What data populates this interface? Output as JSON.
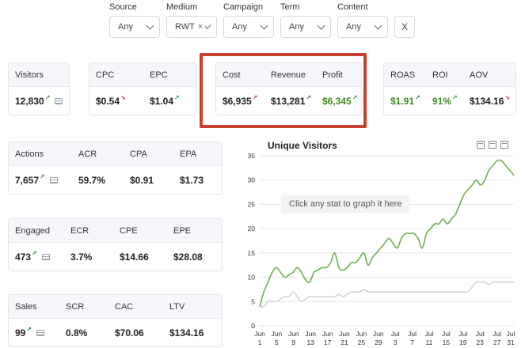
{
  "filters": {
    "source": {
      "label": "Source",
      "value": "Any"
    },
    "medium": {
      "label": "Medium",
      "value": "RWT",
      "clear": "×"
    },
    "campaign": {
      "label": "Campaign",
      "value": "Any"
    },
    "term": {
      "label": "Term",
      "value": "Any"
    },
    "content": {
      "label": "Content",
      "value": "Any"
    },
    "clear_all_label": "X"
  },
  "cards": {
    "visitors": {
      "label": "Visitors",
      "value": "12,830",
      "trend": "up"
    },
    "cpc": {
      "label": "CPC",
      "value": "$0.54",
      "trend": "down"
    },
    "epc": {
      "label": "EPC",
      "value": "$1.04",
      "trend": "up"
    },
    "cost": {
      "label": "Cost",
      "value": "$6,935",
      "trend": "up"
    },
    "revenue": {
      "label": "Revenue",
      "value": "$13,281",
      "trend": "up"
    },
    "profit": {
      "label": "Profit",
      "value": "$6,345",
      "trend": "up"
    },
    "roas": {
      "label": "ROAS",
      "value": "$1.91",
      "trend": "up"
    },
    "roi": {
      "label": "ROI",
      "value": "91%",
      "trend": "up"
    },
    "aov": {
      "label": "AOV",
      "value": "$134.16",
      "trend": "down"
    },
    "actions": {
      "label": "Actions",
      "value": "7,657",
      "trend": "up"
    },
    "acr": {
      "label": "ACR",
      "value": "59.7%"
    },
    "cpa": {
      "label": "CPA",
      "value": "$0.91"
    },
    "epa": {
      "label": "EPA",
      "value": "$1.73"
    },
    "engaged": {
      "label": "Engaged",
      "value": "473",
      "trend": "up"
    },
    "ecr": {
      "label": "ECR",
      "value": "3.7%"
    },
    "cpe": {
      "label": "CPE",
      "value": "$14.66"
    },
    "epe": {
      "label": "EPE",
      "value": "$28.08"
    },
    "sales": {
      "label": "Sales",
      "value": "99",
      "trend": "up"
    },
    "scr": {
      "label": "SCR",
      "value": "0.8%"
    },
    "cac": {
      "label": "CAC",
      "value": "$70.06"
    },
    "ltv": {
      "label": "LTV",
      "value": "$134.16"
    }
  },
  "arrows": {
    "up": "↗",
    "down": "↘"
  },
  "colors": {
    "positive": "#3d8a1f",
    "highlight": "#c9412e",
    "series_primary": "#6fae4e",
    "series_secondary": "#cfcfcf"
  },
  "chart": {
    "title": "Unique Visitors",
    "hint": "Click any stat to graph it here"
  },
  "chart_data": {
    "type": "line",
    "title": "Unique Visitors",
    "ylim": [
      0,
      35
    ],
    "yticks": [
      0,
      5,
      10,
      15,
      20,
      25,
      30,
      35
    ],
    "x_ticks": [
      {
        "month": "Jun",
        "day": "1"
      },
      {
        "month": "Jun",
        "day": "5"
      },
      {
        "month": "Jun",
        "day": "9"
      },
      {
        "month": "Jun",
        "day": "13"
      },
      {
        "month": "Jun",
        "day": "17"
      },
      {
        "month": "Jun",
        "day": "21"
      },
      {
        "month": "Jun",
        "day": "25"
      },
      {
        "month": "Jun",
        "day": "29"
      },
      {
        "month": "Jul",
        "day": "3"
      },
      {
        "month": "Jul",
        "day": "7"
      },
      {
        "month": "Jul",
        "day": "11"
      },
      {
        "month": "Jul",
        "day": "15"
      },
      {
        "month": "Jul",
        "day": "19"
      },
      {
        "month": "Jul",
        "day": "23"
      },
      {
        "month": "Jul",
        "day": "27"
      },
      {
        "month": "Jul",
        "day": "31"
      }
    ],
    "x": [
      1,
      2,
      3,
      4,
      5,
      6,
      7,
      8,
      9,
      10,
      11,
      12,
      13,
      14,
      15,
      16,
      17,
      18,
      19,
      20,
      21,
      22,
      23,
      24,
      25,
      26,
      27,
      28,
      29,
      30,
      31,
      32,
      33,
      34,
      35,
      36,
      37,
      38,
      39,
      40,
      41,
      42,
      43,
      44,
      45,
      46,
      47,
      48,
      49,
      50,
      51,
      52,
      53,
      54,
      55,
      56,
      57,
      58,
      59,
      60,
      61,
      62
    ],
    "series": [
      {
        "values": [
          4,
          7,
          9,
          11,
          12,
          11,
          10,
          10.5,
          11,
          12,
          11,
          9.5,
          9,
          11,
          11.5,
          12,
          12,
          13,
          15,
          12,
          11.5,
          12,
          13,
          13,
          14,
          15,
          12.5,
          14,
          15,
          16,
          17,
          18,
          17,
          16,
          18,
          19,
          19,
          19,
          18,
          16,
          19,
          20,
          21,
          21,
          22,
          21,
          22,
          23,
          25,
          27,
          28,
          29,
          30,
          29,
          30,
          32,
          33,
          34,
          34,
          33,
          32,
          31
        ]
      },
      {
        "values": [
          4,
          4,
          5,
          5,
          5,
          5.5,
          6,
          6,
          7,
          6,
          5,
          5.5,
          6,
          6,
          6,
          6,
          6,
          6,
          6,
          6.5,
          6,
          6.5,
          7,
          7,
          7,
          7.5,
          7,
          7,
          7,
          7,
          7,
          7,
          7,
          7,
          7,
          7,
          7,
          7,
          7,
          7,
          7,
          7,
          7,
          7,
          7,
          7,
          7,
          7,
          7,
          7,
          7,
          8,
          9,
          9,
          9,
          8.5,
          9,
          9,
          9,
          9,
          9,
          9
        ]
      }
    ]
  }
}
